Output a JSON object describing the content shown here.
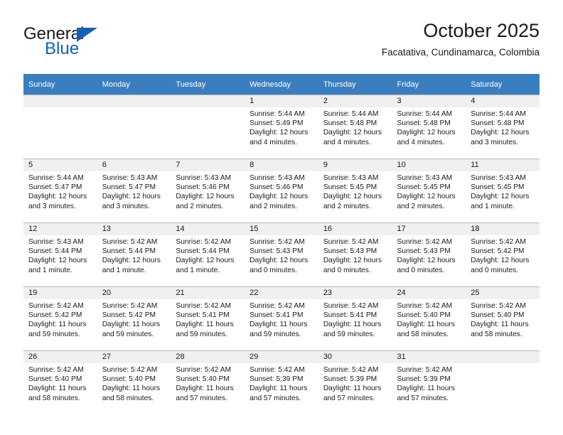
{
  "logo": {
    "word1": "General",
    "word2": "Blue",
    "triangle_color": "#1262b3"
  },
  "header": {
    "title": "October 2025",
    "subtitle": "Facatativa, Cundinamarca, Colombia"
  },
  "theme": {
    "header_row_bg": "#3a7ebf",
    "daynum_bg": "#f0f0f0",
    "grid_line": "#b8b8b8"
  },
  "weekday_headers": [
    "Sunday",
    "Monday",
    "Tuesday",
    "Wednesday",
    "Thursday",
    "Friday",
    "Saturday"
  ],
  "labels": {
    "sunrise_prefix": "Sunrise:",
    "sunset_prefix": "Sunset:",
    "daylight_prefix": "Daylight:"
  },
  "weeks": [
    [
      {
        "day": "",
        "empty": true
      },
      {
        "day": "",
        "empty": true
      },
      {
        "day": "",
        "empty": true
      },
      {
        "day": "1",
        "sunrise": "Sunrise: 5:44 AM",
        "sunset": "Sunset: 5:49 PM",
        "daylight_l1": "Daylight: 12 hours",
        "daylight_l2": "and 4 minutes."
      },
      {
        "day": "2",
        "sunrise": "Sunrise: 5:44 AM",
        "sunset": "Sunset: 5:48 PM",
        "daylight_l1": "Daylight: 12 hours",
        "daylight_l2": "and 4 minutes."
      },
      {
        "day": "3",
        "sunrise": "Sunrise: 5:44 AM",
        "sunset": "Sunset: 5:48 PM",
        "daylight_l1": "Daylight: 12 hours",
        "daylight_l2": "and 4 minutes."
      },
      {
        "day": "4",
        "sunrise": "Sunrise: 5:44 AM",
        "sunset": "Sunset: 5:48 PM",
        "daylight_l1": "Daylight: 12 hours",
        "daylight_l2": "and 3 minutes."
      }
    ],
    [
      {
        "day": "5",
        "sunrise": "Sunrise: 5:44 AM",
        "sunset": "Sunset: 5:47 PM",
        "daylight_l1": "Daylight: 12 hours",
        "daylight_l2": "and 3 minutes."
      },
      {
        "day": "6",
        "sunrise": "Sunrise: 5:43 AM",
        "sunset": "Sunset: 5:47 PM",
        "daylight_l1": "Daylight: 12 hours",
        "daylight_l2": "and 3 minutes."
      },
      {
        "day": "7",
        "sunrise": "Sunrise: 5:43 AM",
        "sunset": "Sunset: 5:46 PM",
        "daylight_l1": "Daylight: 12 hours",
        "daylight_l2": "and 2 minutes."
      },
      {
        "day": "8",
        "sunrise": "Sunrise: 5:43 AM",
        "sunset": "Sunset: 5:46 PM",
        "daylight_l1": "Daylight: 12 hours",
        "daylight_l2": "and 2 minutes."
      },
      {
        "day": "9",
        "sunrise": "Sunrise: 5:43 AM",
        "sunset": "Sunset: 5:45 PM",
        "daylight_l1": "Daylight: 12 hours",
        "daylight_l2": "and 2 minutes."
      },
      {
        "day": "10",
        "sunrise": "Sunrise: 5:43 AM",
        "sunset": "Sunset: 5:45 PM",
        "daylight_l1": "Daylight: 12 hours",
        "daylight_l2": "and 2 minutes."
      },
      {
        "day": "11",
        "sunrise": "Sunrise: 5:43 AM",
        "sunset": "Sunset: 5:45 PM",
        "daylight_l1": "Daylight: 12 hours",
        "daylight_l2": "and 1 minute."
      }
    ],
    [
      {
        "day": "12",
        "sunrise": "Sunrise: 5:43 AM",
        "sunset": "Sunset: 5:44 PM",
        "daylight_l1": "Daylight: 12 hours",
        "daylight_l2": "and 1 minute."
      },
      {
        "day": "13",
        "sunrise": "Sunrise: 5:42 AM",
        "sunset": "Sunset: 5:44 PM",
        "daylight_l1": "Daylight: 12 hours",
        "daylight_l2": "and 1 minute."
      },
      {
        "day": "14",
        "sunrise": "Sunrise: 5:42 AM",
        "sunset": "Sunset: 5:44 PM",
        "daylight_l1": "Daylight: 12 hours",
        "daylight_l2": "and 1 minute."
      },
      {
        "day": "15",
        "sunrise": "Sunrise: 5:42 AM",
        "sunset": "Sunset: 5:43 PM",
        "daylight_l1": "Daylight: 12 hours",
        "daylight_l2": "and 0 minutes."
      },
      {
        "day": "16",
        "sunrise": "Sunrise: 5:42 AM",
        "sunset": "Sunset: 5:43 PM",
        "daylight_l1": "Daylight: 12 hours",
        "daylight_l2": "and 0 minutes."
      },
      {
        "day": "17",
        "sunrise": "Sunrise: 5:42 AM",
        "sunset": "Sunset: 5:43 PM",
        "daylight_l1": "Daylight: 12 hours",
        "daylight_l2": "and 0 minutes."
      },
      {
        "day": "18",
        "sunrise": "Sunrise: 5:42 AM",
        "sunset": "Sunset: 5:42 PM",
        "daylight_l1": "Daylight: 12 hours",
        "daylight_l2": "and 0 minutes."
      }
    ],
    [
      {
        "day": "19",
        "sunrise": "Sunrise: 5:42 AM",
        "sunset": "Sunset: 5:42 PM",
        "daylight_l1": "Daylight: 11 hours",
        "daylight_l2": "and 59 minutes."
      },
      {
        "day": "20",
        "sunrise": "Sunrise: 5:42 AM",
        "sunset": "Sunset: 5:42 PM",
        "daylight_l1": "Daylight: 11 hours",
        "daylight_l2": "and 59 minutes."
      },
      {
        "day": "21",
        "sunrise": "Sunrise: 5:42 AM",
        "sunset": "Sunset: 5:41 PM",
        "daylight_l1": "Daylight: 11 hours",
        "daylight_l2": "and 59 minutes."
      },
      {
        "day": "22",
        "sunrise": "Sunrise: 5:42 AM",
        "sunset": "Sunset: 5:41 PM",
        "daylight_l1": "Daylight: 11 hours",
        "daylight_l2": "and 59 minutes."
      },
      {
        "day": "23",
        "sunrise": "Sunrise: 5:42 AM",
        "sunset": "Sunset: 5:41 PM",
        "daylight_l1": "Daylight: 11 hours",
        "daylight_l2": "and 59 minutes."
      },
      {
        "day": "24",
        "sunrise": "Sunrise: 5:42 AM",
        "sunset": "Sunset: 5:40 PM",
        "daylight_l1": "Daylight: 11 hours",
        "daylight_l2": "and 58 minutes."
      },
      {
        "day": "25",
        "sunrise": "Sunrise: 5:42 AM",
        "sunset": "Sunset: 5:40 PM",
        "daylight_l1": "Daylight: 11 hours",
        "daylight_l2": "and 58 minutes."
      }
    ],
    [
      {
        "day": "26",
        "sunrise": "Sunrise: 5:42 AM",
        "sunset": "Sunset: 5:40 PM",
        "daylight_l1": "Daylight: 11 hours",
        "daylight_l2": "and 58 minutes."
      },
      {
        "day": "27",
        "sunrise": "Sunrise: 5:42 AM",
        "sunset": "Sunset: 5:40 PM",
        "daylight_l1": "Daylight: 11 hours",
        "daylight_l2": "and 58 minutes."
      },
      {
        "day": "28",
        "sunrise": "Sunrise: 5:42 AM",
        "sunset": "Sunset: 5:40 PM",
        "daylight_l1": "Daylight: 11 hours",
        "daylight_l2": "and 57 minutes."
      },
      {
        "day": "29",
        "sunrise": "Sunrise: 5:42 AM",
        "sunset": "Sunset: 5:39 PM",
        "daylight_l1": "Daylight: 11 hours",
        "daylight_l2": "and 57 minutes."
      },
      {
        "day": "30",
        "sunrise": "Sunrise: 5:42 AM",
        "sunset": "Sunset: 5:39 PM",
        "daylight_l1": "Daylight: 11 hours",
        "daylight_l2": "and 57 minutes."
      },
      {
        "day": "31",
        "sunrise": "Sunrise: 5:42 AM",
        "sunset": "Sunset: 5:39 PM",
        "daylight_l1": "Daylight: 11 hours",
        "daylight_l2": "and 57 minutes."
      },
      {
        "day": "",
        "empty": true
      }
    ]
  ]
}
